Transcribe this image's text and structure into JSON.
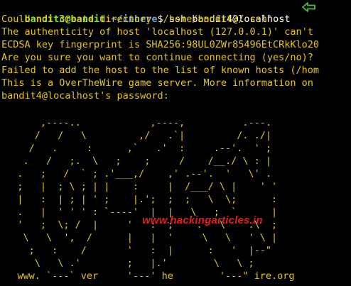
{
  "terminal": {
    "prompt": {
      "user_host": "bandit3@bandit",
      "separator": ":",
      "path": "~/inhere",
      "symbol": "$",
      "command": "ssh bandit4@localhost"
    },
    "output_lines": [
      "Could not create directory '/home/bandit3/.ssh'.",
      "The authenticity of host 'localhost (127.0.0.1)' can't",
      "ECDSA key fingerprint is SHA256:98UL0ZWr85496EtCRkKlo20",
      "Are you sure you want to continue connecting (yes/no)?",
      "Failed to add the host to the list of known hosts (/hom",
      "This is a OverTheWire game server. More information on",
      "bandit4@localhost's password:"
    ],
    "ascii_art": [
      "       ,----..            ,----,          .---.",
      "      /   /   \\         ,/   .`|         /. ./|",
      "     /   .     :      ,`   .'  :     .--'.  ' ;",
      "    .   /   ;.  \\   ;    ;     /    /__./ \\ : |",
      "   .   ;   /  ` ; .'___,/    ,' .--'.  '   \\' .",
      "   ;   |  ; \\ ; | |    :     |  /___/ \\ |    ' '",
      "   |   :  | ; | ' ;    |.';  ;  ;   \\  \\;      :",
      "   .   |  ' ' ' : `----'  |  |   \\   ;  `      |",
      "   '   ;  \\; /  |     '   :  ;    .   \\    .\\  ;",
      "    \\   \\  ',  /      |   |  '     \\   \\   ' \\ |",
      "     ;   :    /       '   :  |      :   '  |--\"",
      "      \\   \\ .'        ;   |.'        \\   \\ ;",
      "   www. `---` ver     '---' he        '---\" ire.org"
    ],
    "watermark": "www.hackingarticles.in"
  },
  "colors": {
    "background": "#000000",
    "output_text": "#e6c619",
    "prompt_user": "#8ae234",
    "prompt_path": "#729fcf",
    "command_text": "#ffffff",
    "arrow": "#4fbf3a",
    "watermark": "#e0201c"
  },
  "icons": {
    "prompt_arrow": "left-arrow-icon"
  }
}
